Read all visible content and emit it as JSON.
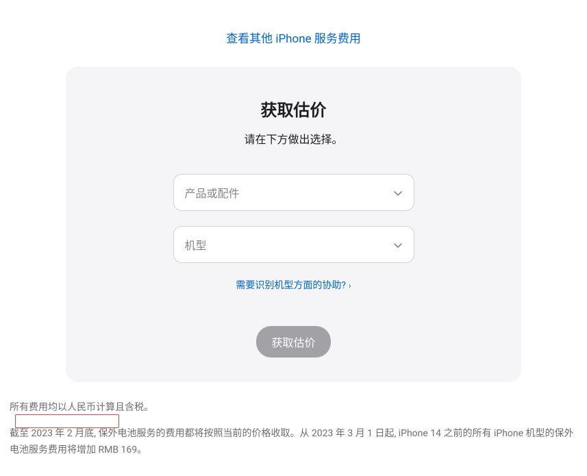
{
  "topLink": {
    "text": "查看其他 iPhone 服务费用"
  },
  "card": {
    "title": "获取估价",
    "subtitle": "请在下方做出选择。",
    "productSelect": {
      "placeholder": "产品或配件"
    },
    "modelSelect": {
      "placeholder": "机型"
    },
    "helpLink": {
      "text": "需要识别机型方面的协助?"
    },
    "submitButton": {
      "label": "获取估价"
    }
  },
  "footnotes": {
    "line1": "所有费用均以人民币计算且含税。",
    "line2": "截至 2023 年 2 月底, 保外电池服务的费用都将按照当前的价格收取。从 2023 年 3 月 1 日起, iPhone 14 之前的所有 iPhone 机型的保外电池服务费用将增加 RMB 169。"
  }
}
